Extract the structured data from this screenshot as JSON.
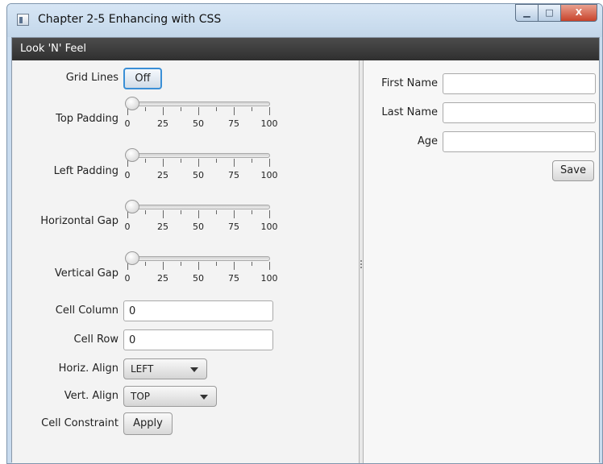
{
  "window": {
    "title": "Chapter 2-5 Enhancing with CSS",
    "min_glyph": "▁",
    "max_glyph": "□",
    "close_glyph": "X"
  },
  "panel": {
    "title": "Look 'N' Feel"
  },
  "left": {
    "grid_lines": {
      "label": "Grid Lines",
      "button": "Off"
    },
    "sliders": [
      {
        "label": "Top Padding",
        "value": 0,
        "ticks": [
          "0",
          "25",
          "50",
          "75",
          "100"
        ]
      },
      {
        "label": "Left Padding",
        "value": 0,
        "ticks": [
          "0",
          "25",
          "50",
          "75",
          "100"
        ]
      },
      {
        "label": "Horizontal Gap",
        "value": 0,
        "ticks": [
          "0",
          "25",
          "50",
          "75",
          "100"
        ]
      },
      {
        "label": "Vertical Gap",
        "value": 0,
        "ticks": [
          "0",
          "25",
          "50",
          "75",
          "100"
        ]
      }
    ],
    "cell_column": {
      "label": "Cell Column",
      "value": "0"
    },
    "cell_row": {
      "label": "Cell Row",
      "value": "0"
    },
    "horiz_align": {
      "label": "Horiz. Align",
      "selected": "LEFT"
    },
    "vert_align": {
      "label": "Vert. Align",
      "selected": "TOP"
    },
    "cell_constraint": {
      "label": "Cell Constraint",
      "button": "Apply"
    }
  },
  "right": {
    "first_name": {
      "label": "First Name",
      "value": ""
    },
    "last_name": {
      "label": "Last Name",
      "value": ""
    },
    "age": {
      "label": "Age",
      "value": ""
    },
    "save_button": "Save"
  }
}
